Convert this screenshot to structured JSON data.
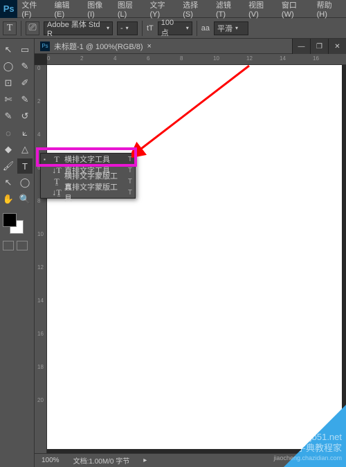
{
  "menubar": {
    "logo": "Ps",
    "items": [
      "文件(F)",
      "编辑(E)",
      "图像(I)",
      "图层(L)",
      "文字(Y)",
      "选择(S)",
      "滤镜(T)",
      "视图(V)",
      "窗口(W)",
      "帮助(H)"
    ]
  },
  "options": {
    "tool_glyph": "T",
    "orient_glyph": "⎚",
    "font_family": "Adobe 黑体 Std R",
    "font_style": "-",
    "size_icon": "tT",
    "size_value": "100 点",
    "aa_icon": "aa",
    "aa_value": "平滑"
  },
  "document": {
    "badge": "Ps",
    "title": "未标题-1 @ 100%(RGB/8)",
    "close": "×",
    "ruler_h": [
      "0",
      "2",
      "4",
      "6",
      "8",
      "10",
      "12",
      "14",
      "16"
    ],
    "ruler_v": [
      "0",
      "2",
      "4",
      "6",
      "8",
      "10",
      "12",
      "14",
      "16",
      "18",
      "20"
    ]
  },
  "tools": {
    "row1": [
      "↖",
      "▭"
    ],
    "row2": [
      "◯",
      "✎"
    ],
    "row3": [
      "⊡",
      "✐"
    ],
    "row4": [
      "✄",
      "✎"
    ],
    "row5": [
      "✎",
      "↺"
    ],
    "row6": [
      "◌",
      "⟀"
    ],
    "row7": [
      "◆",
      "△"
    ],
    "row8": [
      "🖌",
      "◐"
    ],
    "row9": [
      "🖊",
      "T"
    ],
    "row10": [
      "↖",
      "◯"
    ],
    "row11": [
      "✋",
      "🔍"
    ]
  },
  "flyout": {
    "items": [
      {
        "check": "▪",
        "icon": "T",
        "label": "横排文字工具",
        "key": "T"
      },
      {
        "check": "",
        "icon": "↓T",
        "label": "直排文字工具",
        "key": "T"
      },
      {
        "check": "",
        "icon": "T̤",
        "label": "横排文字蒙版工具",
        "key": "T"
      },
      {
        "check": "",
        "icon": "↓T̤",
        "label": "直排文字蒙版工具",
        "key": "T"
      }
    ]
  },
  "status": {
    "zoom": "100%",
    "doc_info": "文档:1.00M/0 字节"
  },
  "window_buttons": {
    "min": "—",
    "max": "❐",
    "close": "✕"
  },
  "watermark": {
    "site": "jb51.net",
    "brand": "字典教程家",
    "url": "jiaocheng.chazidian.com"
  }
}
